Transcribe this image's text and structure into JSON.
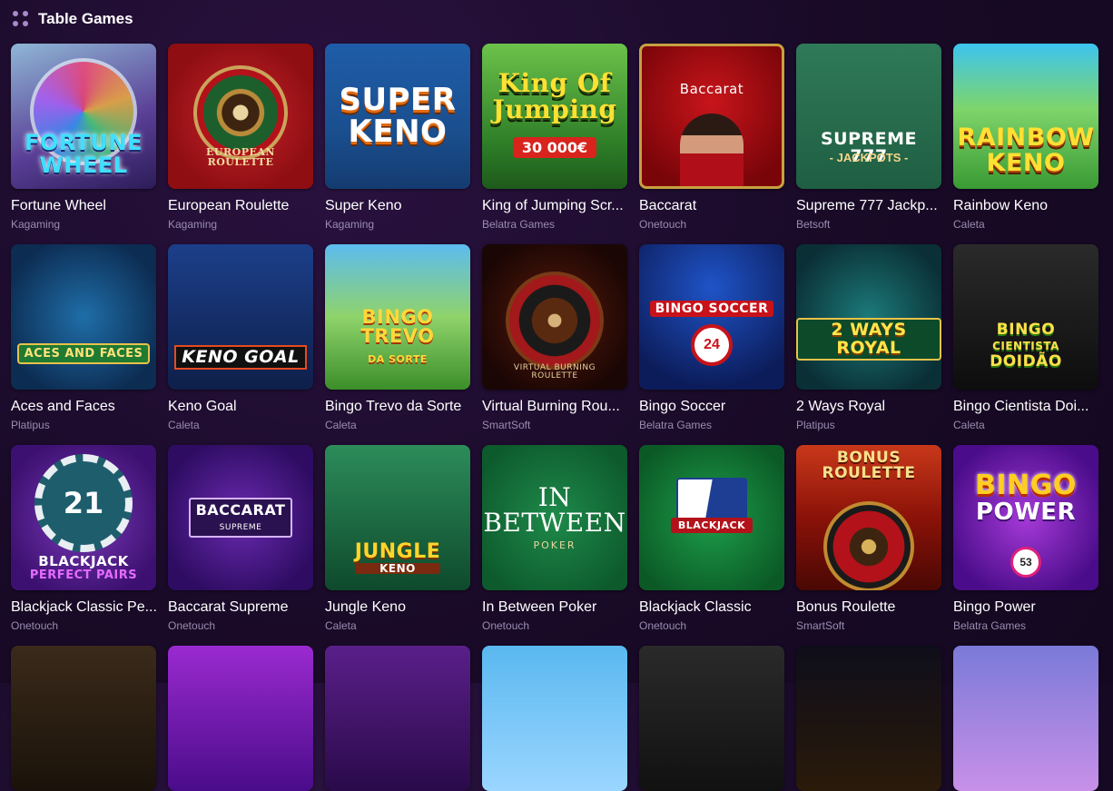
{
  "header": {
    "title": "Table Games",
    "icon": "grid-dots-icon"
  },
  "games": [
    {
      "name": "Fortune Wheel",
      "provider": "Kagaming",
      "art": [
        "FORTUNE",
        "WHEEL"
      ]
    },
    {
      "name": "European Roulette",
      "provider": "Kagaming",
      "art": [
        "EUROPEAN",
        "ROULETTE"
      ]
    },
    {
      "name": "Super Keno",
      "provider": "Kagaming",
      "art": [
        "SUPER",
        "KENO"
      ]
    },
    {
      "name": "King of Jumping Scr...",
      "provider": "Belatra Games",
      "art": [
        "King Of",
        "Jumping",
        "30 000€"
      ]
    },
    {
      "name": "Baccarat",
      "provider": "Onetouch",
      "art": [
        "Baccarat"
      ]
    },
    {
      "name": "Supreme 777 Jackp...",
      "provider": "Betsoft",
      "art": [
        "SUPREME 777",
        "- JACKPOTS -"
      ]
    },
    {
      "name": "Rainbow Keno",
      "provider": "Caleta",
      "art": [
        "RAINBOW",
        "KENO"
      ]
    },
    {
      "name": "Aces and Faces",
      "provider": "Platipus",
      "art": [
        "ACES AND FACES"
      ]
    },
    {
      "name": "Keno Goal",
      "provider": "Caleta",
      "art": [
        "KENO GOAL"
      ]
    },
    {
      "name": "Bingo Trevo da Sorte",
      "provider": "Caleta",
      "art": [
        "BINGO",
        "TREVO",
        "DA SORTE"
      ]
    },
    {
      "name": "Virtual Burning Rou...",
      "provider": "SmartSoft",
      "art": [
        "VIRTUAL BURNING",
        "ROULETTE"
      ]
    },
    {
      "name": "Bingo Soccer",
      "provider": "Belatra Games",
      "art": [
        "BINGO SOCCER",
        "24"
      ]
    },
    {
      "name": "2 Ways Royal",
      "provider": "Platipus",
      "art": [
        "2 WAYS ROYAL"
      ]
    },
    {
      "name": "Bingo Cientista Doi...",
      "provider": "Caleta",
      "art": [
        "BINGO",
        "CIENTISTA",
        "DOIDÃO"
      ]
    },
    {
      "name": "Blackjack Classic Pe...",
      "provider": "Onetouch",
      "art": [
        "21",
        "BLACKJACK",
        "PERFECT PAIRS"
      ]
    },
    {
      "name": "Baccarat Supreme",
      "provider": "Onetouch",
      "art": [
        "BACCARAT",
        "SUPREME"
      ]
    },
    {
      "name": "Jungle Keno",
      "provider": "Caleta",
      "art": [
        "JUNGLE",
        "KENO"
      ]
    },
    {
      "name": "In Between Poker",
      "provider": "Onetouch",
      "art": [
        "IN",
        "BETWEEN",
        "POKER"
      ]
    },
    {
      "name": "Blackjack Classic",
      "provider": "Onetouch",
      "art": [
        "BLACKJACK"
      ]
    },
    {
      "name": "Bonus Roulette",
      "provider": "SmartSoft",
      "art": [
        "BONUS ROULETTE"
      ]
    },
    {
      "name": "Bingo Power",
      "provider": "Belatra Games",
      "art": [
        "BINGO",
        "POWER",
        "53"
      ]
    }
  ]
}
